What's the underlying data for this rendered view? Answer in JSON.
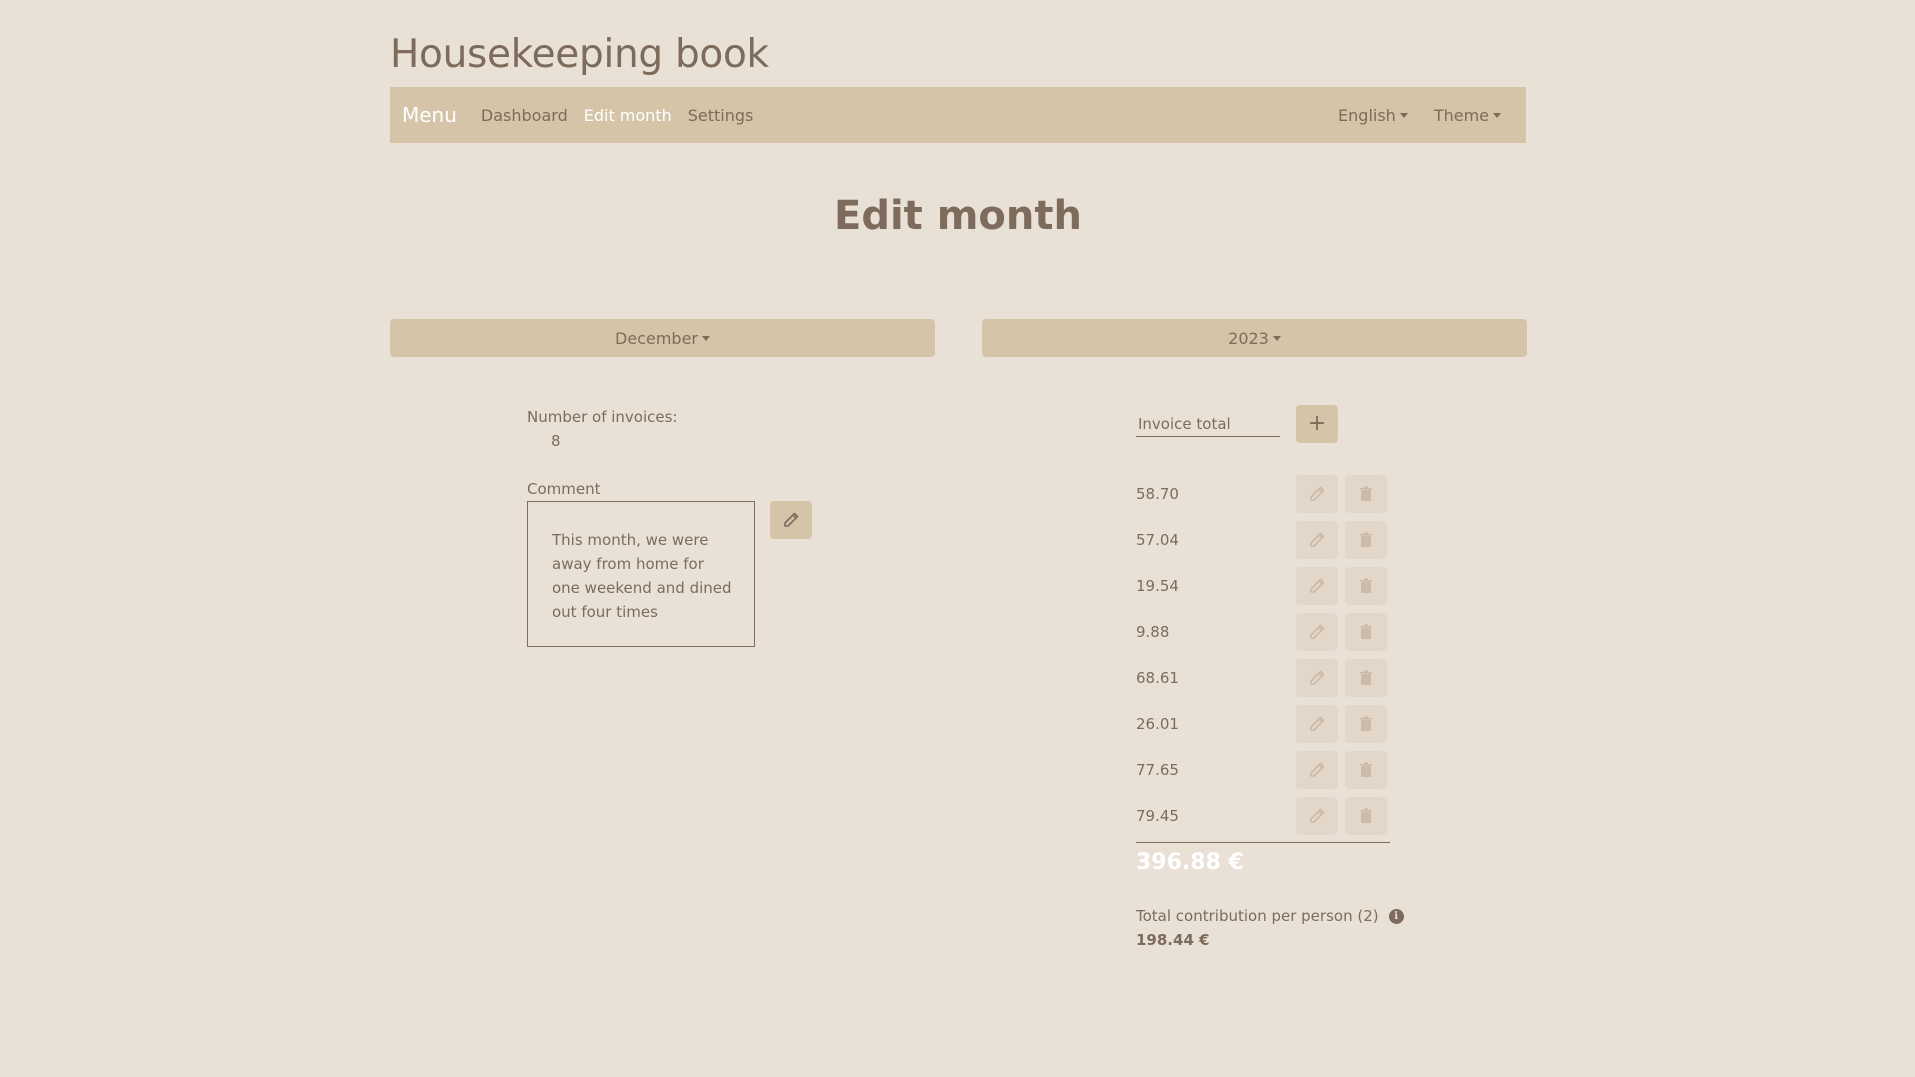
{
  "app": {
    "title": "Housekeeping book"
  },
  "nav": {
    "brand": "Menu",
    "links": [
      "Dashboard",
      "Edit month",
      "Settings"
    ],
    "active": "Edit month",
    "language": "English",
    "theme": "Theme"
  },
  "page": {
    "heading": "Edit month"
  },
  "selectors": {
    "month": "December",
    "year": "2023"
  },
  "info": {
    "invoices_label": "Number of invoices:",
    "invoices_count": "8",
    "comment_label": "Comment",
    "comment_text": "This month, we were away from home for one weekend and dined out four times"
  },
  "invoices": {
    "input_placeholder": "Invoice total",
    "add_label": "+",
    "values": [
      "58.70",
      "57.04",
      "19.54",
      "9.88",
      "68.61",
      "26.01",
      "77.65",
      "79.45"
    ],
    "total": "396.88 €"
  },
  "contribution": {
    "label": "Total contribution per person (2)",
    "value": "198.44 €"
  },
  "icons": {
    "edit": "pencil-icon",
    "delete": "trash-icon",
    "info": "info-icon",
    "add": "plus-icon"
  },
  "colors": {
    "background": "#eae1d6",
    "accent": "#d6c4a9",
    "text": "#7d6c5c"
  }
}
